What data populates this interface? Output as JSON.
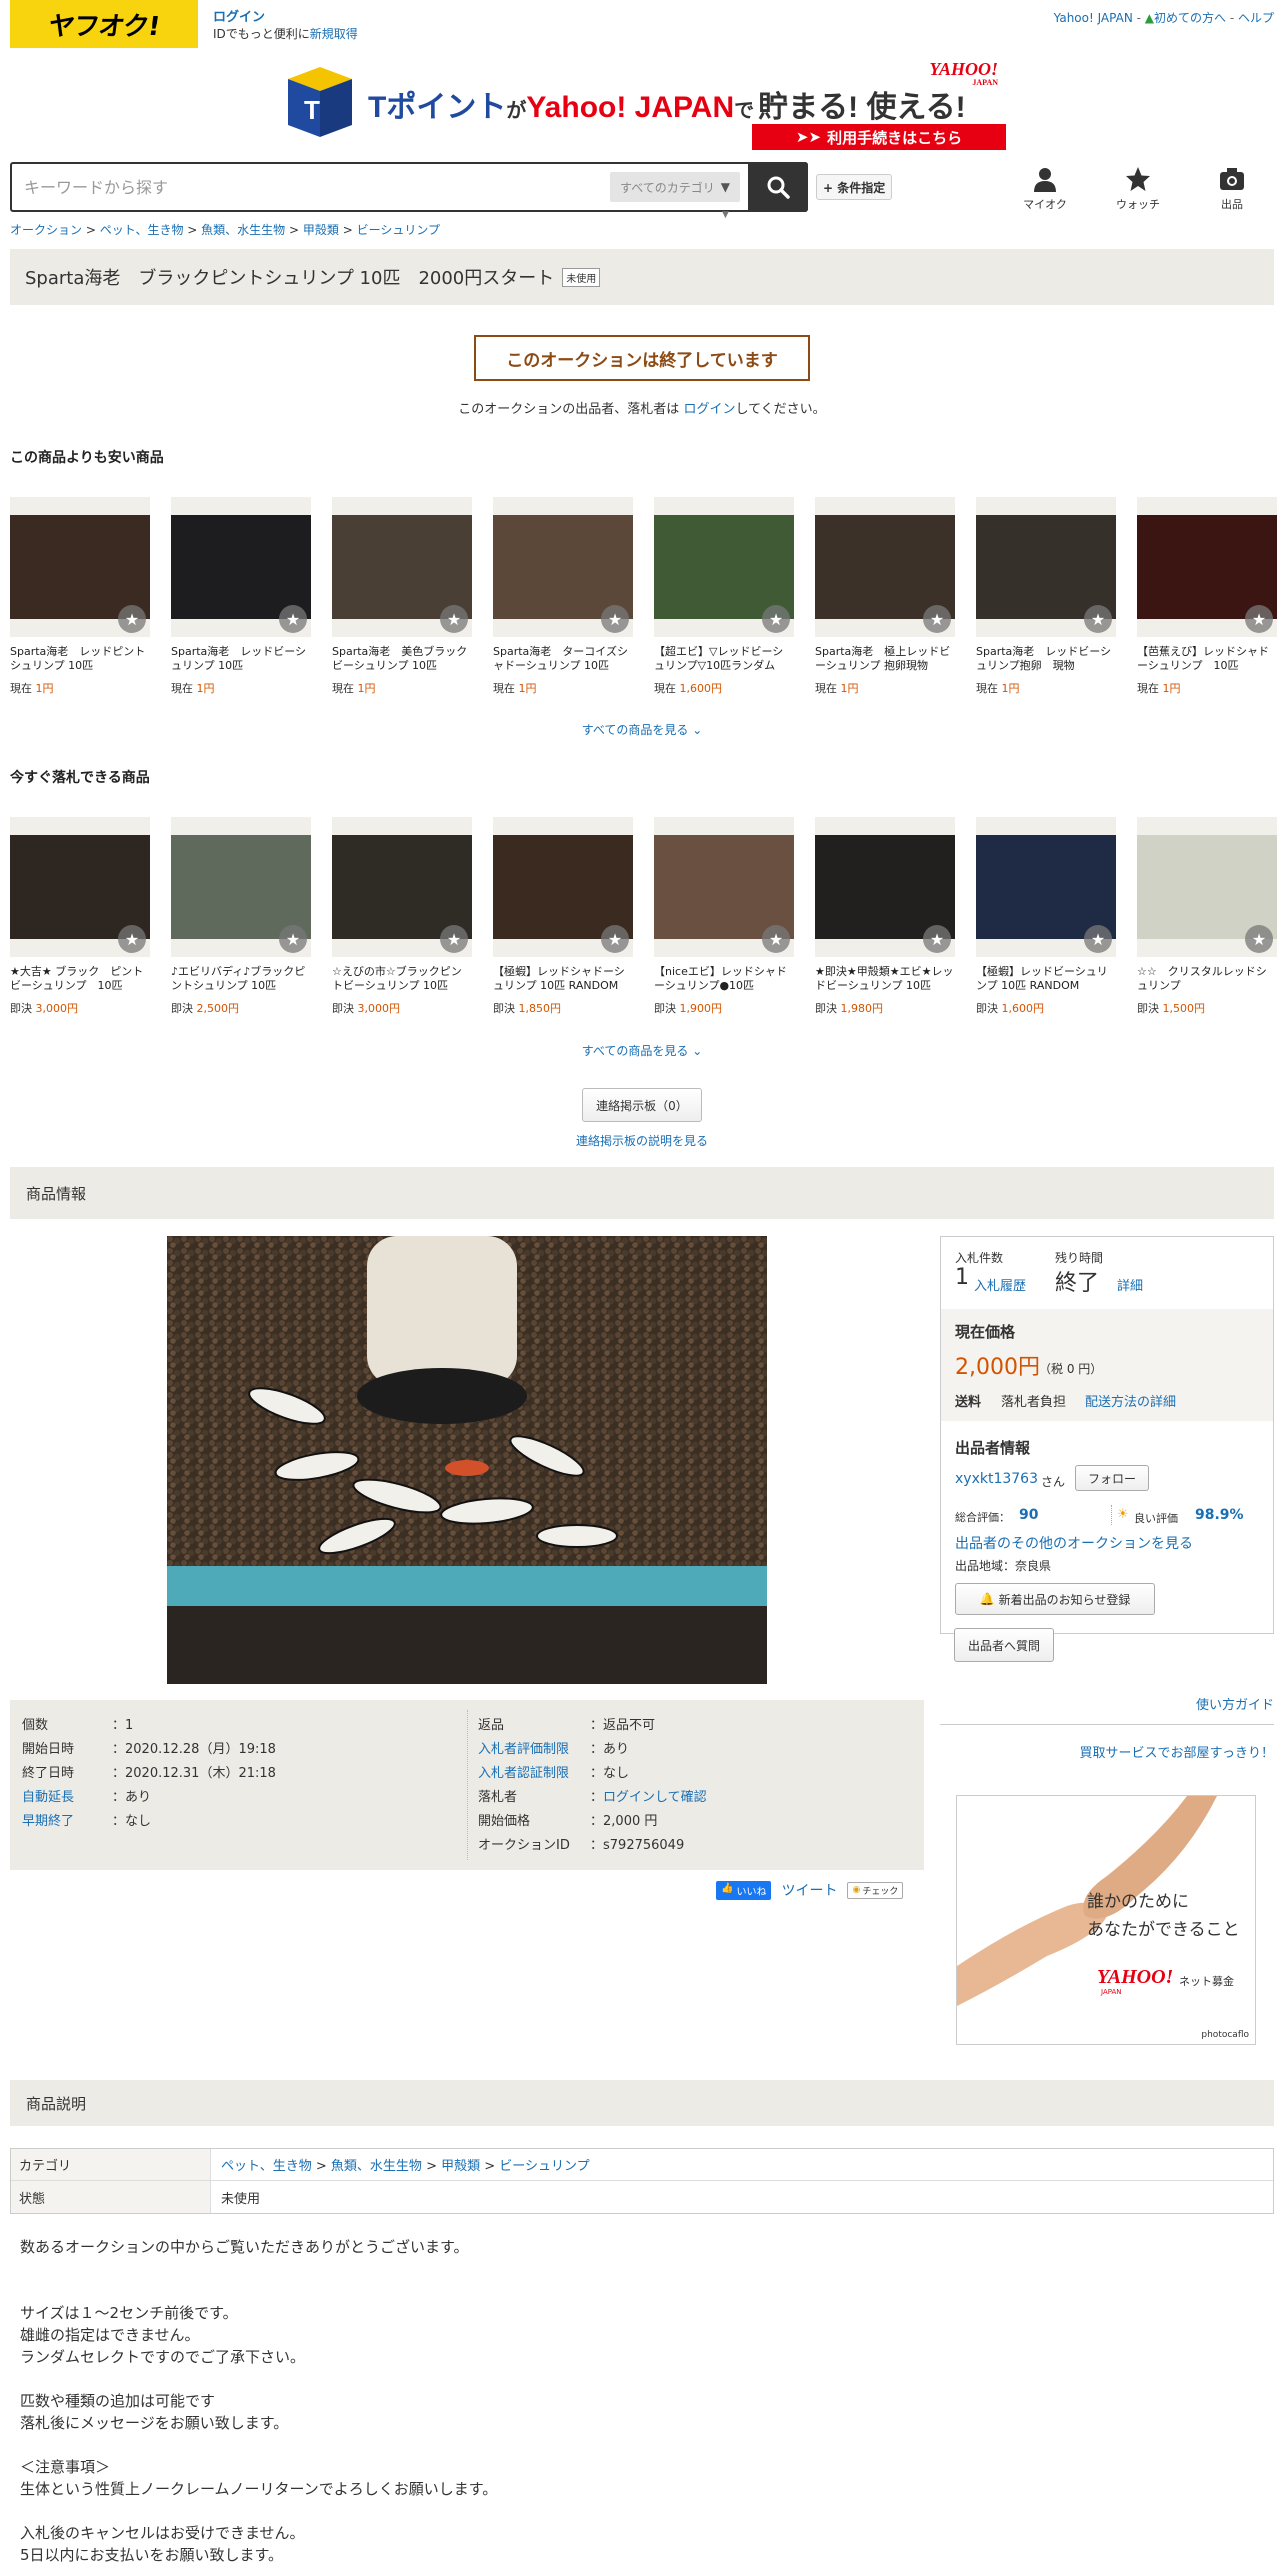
{
  "header": {
    "logo_text": "ヤフオク!",
    "login_label": "ログイン",
    "login_sub": "IDでもっと便利に",
    "signup_link": "新規取得",
    "top_links": [
      "Yahoo! JAPAN",
      "初めての方へ",
      "ヘルプ"
    ],
    "banner": {
      "t_logo": "T",
      "text_pre": "Tポイント",
      "text_ga": "が",
      "text_yj": "Yahoo! JAPAN",
      "text_de": "で",
      "text_main": "貯まる! 使える!",
      "yahoo_logo": "YAHOO!",
      "yahoo_sub": "JAPAN",
      "cta": "利用手続きはこちら"
    },
    "search_placeholder": "キーワードから探す",
    "category_select": "すべてのカテゴリ",
    "condition_button": "+ 条件指定",
    "nav": {
      "myauction": "マイオク",
      "watch": "ウォッチ",
      "sell": "出品"
    }
  },
  "breadcrumbs": [
    "オークション",
    "ペット、生き物",
    "魚類、水生生物",
    "甲殻類",
    "ビーシュリンプ"
  ],
  "listing": {
    "title": "Sparta海老　ブラックピントシュリンプ 10匹　2000円スタート",
    "condition_badge": "未使用",
    "ended_notice": "このオークションは終了しています",
    "ended_msg_pre": "このオークションの出品者、落札者は ",
    "ended_msg_link": "ログイン",
    "ended_msg_post": "してください。"
  },
  "cheaper": {
    "heading": "この商品よりも安い商品",
    "see_all": "すべての商品を見る",
    "items": [
      {
        "name": "Sparta海老　レッドピントシュリンプ 10匹",
        "price_label": "現在",
        "price": "1円",
        "color": "#3a2a22"
      },
      {
        "name": "Sparta海老　レッドビーシュリンプ 10匹",
        "price_label": "現在",
        "price": "1円",
        "color": "#1d1d20"
      },
      {
        "name": "Sparta海老　美色ブラックビーシュリンプ 10匹",
        "price_label": "現在",
        "price": "1円",
        "color": "#4a3f35"
      },
      {
        "name": "Sparta海老　ターコイズシャドーシュリンプ 10匹",
        "price_label": "現在",
        "price": "1円",
        "color": "#5b4838"
      },
      {
        "name": "【超エビ】▽レッドビーシュリンプ▽10匹ランダム",
        "price_label": "現在",
        "price": "1,600円",
        "color": "#3f5a35"
      },
      {
        "name": "Sparta海老　極上レッドビーシュリンプ 抱卵現物",
        "price_label": "現在",
        "price": "1円",
        "color": "#3c3128"
      },
      {
        "name": "Sparta海老　レッドビーシュリンプ抱卵　現物",
        "price_label": "現在",
        "price": "1円",
        "color": "#35302a"
      },
      {
        "name": "【芭蕉えび】レッドシャドーシュリンプ　10匹",
        "price_label": "現在",
        "price": "1円",
        "color": "#3a1512"
      }
    ]
  },
  "buynow": {
    "heading": "今すぐ落札できる商品",
    "see_all": "すべての商品を見る",
    "items": [
      {
        "name": "★大吉★ ブラック　ピントビーシュリンプ　10匹",
        "price_label": "即決",
        "price": "3,000円",
        "color": "#2e2620"
      },
      {
        "name": "♪エビリバディ♪ブラックピントシュリンプ 10匹",
        "price_label": "即決",
        "price": "2,500円",
        "color": "#5f6a5c"
      },
      {
        "name": "☆えびの市☆ブラックピントビーシュリンプ 10匹",
        "price_label": "即決",
        "price": "3,000円",
        "color": "#2f2c25"
      },
      {
        "name": "【極蝦】レッドシャドーシュリンプ 10匹 RANDOM",
        "price_label": "即決",
        "price": "1,850円",
        "color": "#3b2a20"
      },
      {
        "name": "【niceエビ】レッドシャドーシュリンプ●10匹",
        "price_label": "即決",
        "price": "1,900円",
        "color": "#6a5040"
      },
      {
        "name": "★即決★甲殻類★エビ★レッドビーシュリンプ 10匹",
        "price_label": "即決",
        "price": "1,980円",
        "color": "#22201f"
      },
      {
        "name": "【極蝦】レッドビーシュリンプ 10匹 RANDOM",
        "price_label": "即決",
        "price": "1,600円",
        "color": "#1f2a45"
      },
      {
        "name": "☆☆　クリスタルレッドシュリンプ",
        "price_label": "即決",
        "price": "1,500円",
        "color": "#cfd2c4"
      }
    ]
  },
  "bbs": {
    "button": "連絡掲示板（0）",
    "link": "連絡掲示板の説明を見る"
  },
  "product_info_heading": "商品情報",
  "details_left": [
    {
      "k": "個数",
      "v": "1",
      "link": false
    },
    {
      "k": "開始日時",
      "v": "2020.12.28（月）19:18",
      "link": false
    },
    {
      "k": "終了日時",
      "v": "2020.12.31（木）21:18",
      "link": false
    },
    {
      "k": "自動延長",
      "v": "あり",
      "link": true
    },
    {
      "k": "早期終了",
      "v": "なし",
      "link": true
    }
  ],
  "details_right": [
    {
      "k": "返品",
      "v": "返品不可",
      "link": false,
      "vlink": false
    },
    {
      "k": "入札者評価制限",
      "v": "あり",
      "link": true,
      "vlink": false
    },
    {
      "k": "入札者認証制限",
      "v": "なし",
      "link": true,
      "vlink": false
    },
    {
      "k": "落札者",
      "v": "ログインして確認",
      "link": false,
      "vlink": true
    },
    {
      "k": "開始価格",
      "v": "2,000 円",
      "link": false,
      "vlink": false
    },
    {
      "k": "オークションID",
      "v": "s792756049",
      "link": false,
      "vlink": false
    }
  ],
  "bid_panel": {
    "bids_label": "入札件数",
    "bids_count": "1",
    "bid_history": "入札履歴",
    "time_label": "残り時間",
    "time_value": "終了",
    "time_detail": "詳細",
    "price_heading": "現在価格",
    "price": "2,000円",
    "tax": "（税 0 円）",
    "shipping_label": "送料",
    "shipping_value": "落札者負担",
    "shipping_link": "配送方法の詳細",
    "seller_heading": "出品者情報",
    "seller_name": "xyxkt13763",
    "seller_suffix": "さん",
    "follow": "フォロー",
    "rating_label": "総合評価：",
    "rating_value": "90",
    "good_label": "良い評価",
    "good_value": "98.9%",
    "other_auctions": "出品者のその他のオークションを見る",
    "region": "出品地域：奈良県",
    "notify_button": "新着出品のお知らせ登録",
    "question_button": "出品者へ質問"
  },
  "share": {
    "like": "いいね",
    "tweet": "ツイート",
    "check": "チェック"
  },
  "guide_link": "使い方ガイド",
  "kaitori_link": "買取サービスでお部屋すっきり！",
  "ad": {
    "line1": "誰かのために",
    "line2": "あなたができること",
    "brand": "YAHOO!",
    "brand_sub": "JAPAN",
    "brand_suffix": "ネット募金",
    "credit": "photocaflo"
  },
  "description_heading": "商品説明",
  "desc_table": {
    "category_label": "カテゴリ",
    "category_path": [
      "ペット、生き物",
      "魚類、水生生物",
      "甲殻類",
      "ビーシュリンプ"
    ],
    "condition_label": "状態",
    "condition_value": "未使用"
  },
  "description": [
    "数あるオークションの中からご覧いただきありがとうございます。",
    "",
    "",
    "サイズは１～2センチ前後です。",
    "雄雌の指定はできません。",
    "ランダムセレクトですのでご了承下さい。",
    "",
    "匹数や種類の追加は可能です",
    "落札後にメッセージをお願い致します。",
    "",
    "＜注意事項＞",
    "生体という性質上ノークレームノーリターンでよろしくお願いします。",
    "",
    "入札後のキャンセルはお受けできません。",
    "5日以内にお支払いをお願い致します。"
  ]
}
